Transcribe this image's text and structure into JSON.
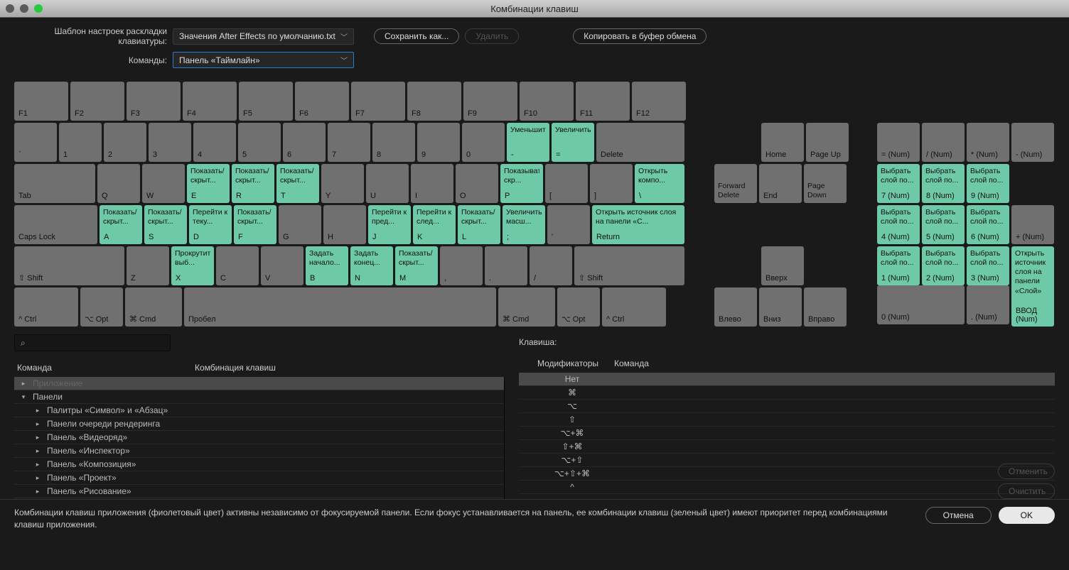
{
  "window": {
    "title": "Комбинации клавиш"
  },
  "toolbar": {
    "preset_label": "Шаблон настроек раскладки клавиатуры:",
    "preset_value": "Значения After Effects по умолчанию.txt",
    "commands_label": "Команды:",
    "commands_value": "Панель «Таймлайн»",
    "save_as": "Сохранить как...",
    "delete": "Удалить",
    "copy": "Копировать в буфер обмена"
  },
  "keys": {
    "f1": "F1",
    "f2": "F2",
    "f3": "F3",
    "f4": "F4",
    "f5": "F5",
    "f6": "F6",
    "f7": "F7",
    "f8": "F8",
    "f9": "F9",
    "f10": "F10",
    "f11": "F11",
    "f12": "F12",
    "backtick": "`",
    "k1": "1",
    "k2": "2",
    "k3": "3",
    "k4": "4",
    "k5": "5",
    "k6": "6",
    "k7": "7",
    "k8": "8",
    "k9": "9",
    "k0": "0",
    "minus": "-",
    "minus_cmd": "Уменьшить",
    "equals": "=",
    "equals_cmd": "Увеличить",
    "delete": "Delete",
    "tab": "Tab",
    "q": "Q",
    "w": "W",
    "e": "E",
    "e_cmd": "Показать/скрыт...",
    "r": "R",
    "r_cmd": "Показать/скрыт...",
    "t": "T",
    "t_cmd": "Показать/скрыт...",
    "y": "Y",
    "u": "U",
    "i": "I",
    "o": "O",
    "p": "P",
    "p_cmd": "Показывать/скр...",
    "lbr": "[",
    "rbr": "]",
    "bslash": "\\",
    "bslash_cmd": "Открыть компо...",
    "caps": "Caps Lock",
    "a": "A",
    "a_cmd": "Показать/скрыт...",
    "s": "S",
    "s_cmd": "Показать/скрыт...",
    "d": "D",
    "d_cmd": "Перейти к теку...",
    "f": "F",
    "f_cmd": "Показать/скрыт...",
    "g": "G",
    "h": "H",
    "j": "J",
    "j_cmd": "Перейти к пред...",
    "k": "K",
    "k_cmd": "Перейти к след...",
    "l": "L",
    "l_cmd": "Показать/скрыт...",
    "semi": ";",
    "semi_cmd": "Увеличить масш...",
    "quote": "'",
    "return": "Return",
    "return_cmd": "Открыть источник слоя на панели «С...",
    "shiftl": "⇧ Shift",
    "z": "Z",
    "x": "X",
    "x_cmd": "Прокрутить выб...",
    "c": "C",
    "v": "V",
    "b": "B",
    "b_cmd": "Задать начало...",
    "n": "N",
    "n_cmd": "Задать конец...",
    "m": "M",
    "m_cmd": "Показать/скрыт...",
    "comma": ",",
    "period": ".",
    "slash": "/",
    "shiftr": "⇧ Shift",
    "ctrll": "^ Ctrl",
    "optl": "⌥ Opt",
    "cmdl": "⌘ Cmd",
    "space": "Пробел",
    "cmdr": "⌘ Cmd",
    "optr": "⌥ Opt",
    "ctrlr": "^ Ctrl",
    "home": "Home",
    "pgup": "Page Up",
    "fwddel": "Forward Delete",
    "end": "End",
    "pgdn": "Page Down",
    "up": "Вверх",
    "left": "Влево",
    "down": "Вниз",
    "right": "Вправо",
    "numeq": "= (Num)",
    "numdiv": "/ (Num)",
    "nummul": "* (Num)",
    "numsub": "- (Num)",
    "num7": "7 (Num)",
    "num7_cmd": "Выбрать слой по...",
    "num8": "8 (Num)",
    "num8_cmd": "Выбрать слой по...",
    "num9": "9 (Num)",
    "num9_cmd": "Выбрать слой по...",
    "num4": "4 (Num)",
    "num4_cmd": "Выбрать слой по...",
    "num5": "5 (Num)",
    "num5_cmd": "Выбрать слой по...",
    "num6": "6 (Num)",
    "num6_cmd": "Выбрать слой по...",
    "numadd": "+ (Num)",
    "num1": "1 (Num)",
    "num1_cmd": "Выбрать слой по...",
    "num2": "2 (Num)",
    "num2_cmd": "Выбрать слой по...",
    "num3": "3 (Num)",
    "num3_cmd": "Выбрать слой по...",
    "numenter": "ВВОД (Num)",
    "numenter_cmd": "Открыть источник слоя на панели «Слой»",
    "num0": "0 (Num)",
    "numdec": ". (Num)"
  },
  "lists": {
    "command_col": "Команда",
    "shortcut_col": "Комбинация клавиш",
    "key_label": "Клавиша:",
    "mod_col": "Модификаторы",
    "cmd_col": "Команда",
    "tree": [
      {
        "label": "Приложение",
        "depth": 0,
        "arrow": "▸",
        "sel": true,
        "dim": true
      },
      {
        "label": "Панели",
        "depth": 0,
        "arrow": "▾"
      },
      {
        "label": "Палитры «Символ» и «Абзац»",
        "depth": 1,
        "arrow": "▸"
      },
      {
        "label": "Панели очереди рендеринга",
        "depth": 1,
        "arrow": "▸"
      },
      {
        "label": "Панель «Видеоряд»",
        "depth": 1,
        "arrow": "▸"
      },
      {
        "label": "Панель «Инспектор»",
        "depth": 1,
        "arrow": "▸"
      },
      {
        "label": "Панель «Композиция»",
        "depth": 1,
        "arrow": "▸"
      },
      {
        "label": "Панель «Проект»",
        "depth": 1,
        "arrow": "▸"
      },
      {
        "label": "Панель «Рисование»",
        "depth": 1,
        "arrow": "▸"
      }
    ],
    "mods": [
      {
        "m": "Нет",
        "sel": true
      },
      {
        "m": "⌘"
      },
      {
        "m": "⌥"
      },
      {
        "m": "⇧"
      },
      {
        "m": "⌥+⌘"
      },
      {
        "m": "⇧+⌘"
      },
      {
        "m": "⌥+⇧"
      },
      {
        "m": "⌥+⇧+⌘"
      },
      {
        "m": "^"
      }
    ],
    "undo": "Отменить",
    "clear": "Очистить"
  },
  "footer": {
    "note": "Комбинации клавиш приложения (фиолетовый цвет) активны независимо от фокусируемой панели. Если фокус устанавливается на панель, ее комбинации клавиш (зеленый цвет) имеют приоритет перед комбинациями клавиш приложения.",
    "cancel": "Отмена",
    "ok": "OK"
  }
}
